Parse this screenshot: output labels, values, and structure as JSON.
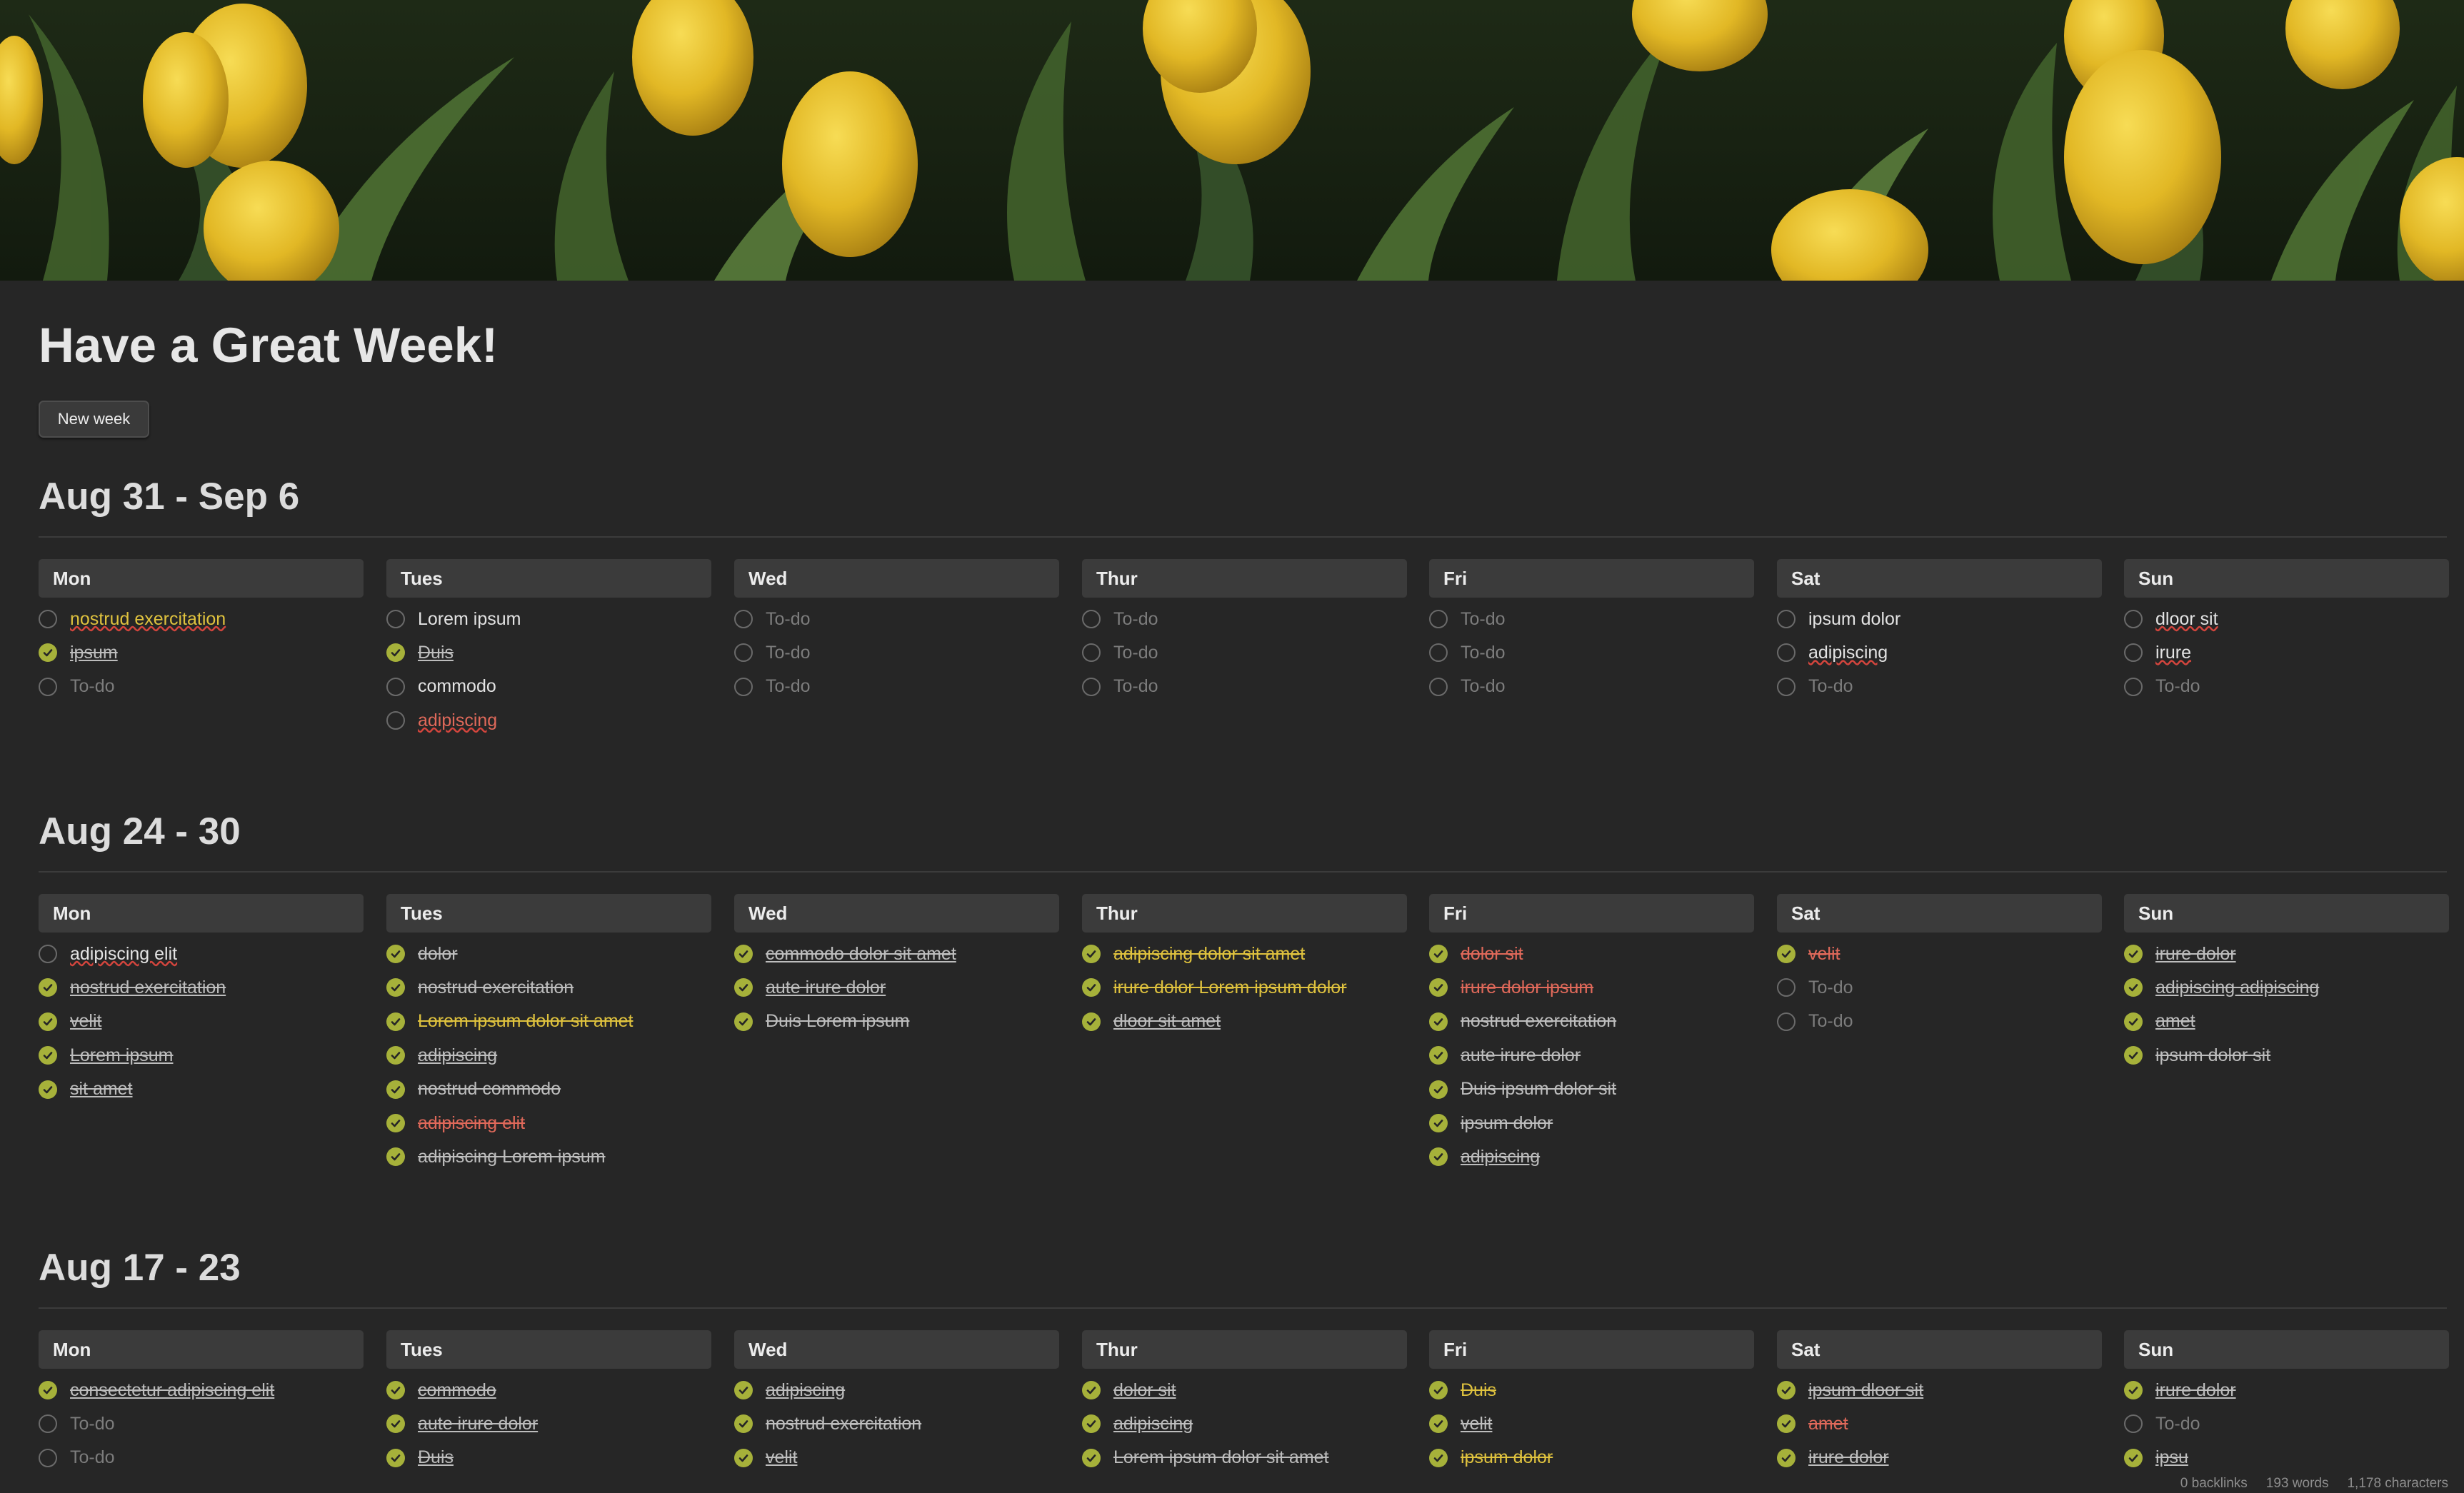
{
  "page": {
    "title": "Have a Great Week!",
    "new_week_button": "New week"
  },
  "colors": {
    "background": "#262626",
    "header_bg": "#3b3b3b",
    "check_done": "#a6b13a",
    "highlight_yellow": "#dfc23e",
    "highlight_red": "#e0695a"
  },
  "weeks": [
    {
      "heading": "Aug 31 - Sep 6",
      "days": [
        {
          "name": "Mon",
          "tasks": [
            {
              "text": "nostrud exercitation",
              "done": false,
              "style": "yellow",
              "spell": true
            },
            {
              "text": "ipsum",
              "done": true,
              "spell": true
            },
            {
              "text": "To-do",
              "done": false,
              "placeholder": true
            }
          ]
        },
        {
          "name": "Tues",
          "tasks": [
            {
              "text": "Lorem ipsum",
              "done": false
            },
            {
              "text": "Duis",
              "done": true,
              "spell": true
            },
            {
              "text": "commodo",
              "done": false
            },
            {
              "text": "adipiscing",
              "done": false,
              "style": "red",
              "spell": true
            }
          ]
        },
        {
          "name": "Wed",
          "tasks": [
            {
              "text": "To-do",
              "done": false,
              "placeholder": true
            },
            {
              "text": "To-do",
              "done": false,
              "placeholder": true
            },
            {
              "text": "To-do",
              "done": false,
              "placeholder": true
            }
          ]
        },
        {
          "name": "Thur",
          "tasks": [
            {
              "text": "To-do",
              "done": false,
              "placeholder": true
            },
            {
              "text": "To-do",
              "done": false,
              "placeholder": true
            },
            {
              "text": "To-do",
              "done": false,
              "placeholder": true
            }
          ]
        },
        {
          "name": "Fri",
          "tasks": [
            {
              "text": "To-do",
              "done": false,
              "placeholder": true
            },
            {
              "text": "To-do",
              "done": false,
              "placeholder": true
            },
            {
              "text": "To-do",
              "done": false,
              "placeholder": true
            }
          ]
        },
        {
          "name": "Sat",
          "tasks": [
            {
              "text": "ipsum dolor",
              "done": false
            },
            {
              "text": "adipiscing",
              "done": false,
              "spell": true
            },
            {
              "text": "To-do",
              "done": false,
              "placeholder": true
            }
          ]
        },
        {
          "name": "Sun",
          "tasks": [
            {
              "text": "dloor sit",
              "done": false,
              "spell": true
            },
            {
              "text": "irure",
              "done": false,
              "spell": true
            },
            {
              "text": "To-do",
              "done": false,
              "placeholder": true
            }
          ]
        }
      ]
    },
    {
      "heading": "Aug 24 - 30",
      "days": [
        {
          "name": "Mon",
          "tasks": [
            {
              "text": "adipiscing elit",
              "done": false,
              "spell": true
            },
            {
              "text": "nostrud exercitation",
              "done": true,
              "spell": true
            },
            {
              "text": "velit",
              "done": true,
              "spell": true
            },
            {
              "text": "Lorem ipsum",
              "done": true,
              "spell": true
            },
            {
              "text": "sit amet",
              "done": true,
              "spell": true
            }
          ]
        },
        {
          "name": "Tues",
          "tasks": [
            {
              "text": "dolor",
              "done": true
            },
            {
              "text": "nostrud exercitation",
              "done": true
            },
            {
              "text": "Lorem ipsum dolor sit amet",
              "done": true,
              "style": "yellow"
            },
            {
              "text": "adipiscing",
              "done": true,
              "spell": true
            },
            {
              "text": "nostrud commodo",
              "done": true
            },
            {
              "text": "adipiscing elit",
              "done": true,
              "style": "red"
            },
            {
              "text": "adipiscing Lorem ipsum",
              "done": true
            }
          ]
        },
        {
          "name": "Wed",
          "tasks": [
            {
              "text": "commodo dolor sit amet",
              "done": true,
              "spell": true
            },
            {
              "text": "aute irure dolor",
              "done": true,
              "spell": true
            },
            {
              "text": "Duis Lorem ipsum",
              "done": true
            }
          ]
        },
        {
          "name": "Thur",
          "tasks": [
            {
              "text": "adipiscing dolor sit amet",
              "done": true,
              "style": "yellow"
            },
            {
              "text": "irure dolor Lorem ipsum dolor",
              "done": true,
              "style": "yellow"
            },
            {
              "text": "dloor sit amet",
              "done": true,
              "spell": true
            }
          ]
        },
        {
          "name": "Fri",
          "tasks": [
            {
              "text": "dolor sit",
              "done": true,
              "style": "red"
            },
            {
              "text": "irure dolor ipsum",
              "done": true,
              "style": "red"
            },
            {
              "text": "nostrud exercitation",
              "done": true
            },
            {
              "text": "aute irure dolor",
              "done": true
            },
            {
              "text": "Duis  ipsum dolor sit",
              "done": true
            },
            {
              "text": "ipsum dolor",
              "done": true
            },
            {
              "text": "adipiscing",
              "done": true,
              "spell": true
            }
          ]
        },
        {
          "name": "Sat",
          "tasks": [
            {
              "text": "velit",
              "done": true,
              "style": "red"
            },
            {
              "text": "To-do",
              "done": false,
              "placeholder": true
            },
            {
              "text": "To-do",
              "done": false,
              "placeholder": true
            }
          ]
        },
        {
          "name": "Sun",
          "tasks": [
            {
              "text": "irure dolor",
              "done": true,
              "spell": true
            },
            {
              "text": "adipiscing adipiscing",
              "done": true,
              "spell": true
            },
            {
              "text": "amet",
              "done": true,
              "spell": true
            },
            {
              "text": "ipsum dolor sit",
              "done": true
            }
          ]
        }
      ]
    },
    {
      "heading": "Aug 17 - 23",
      "days": [
        {
          "name": "Mon",
          "tasks": [
            {
              "text": "consectetur adipiscing elit",
              "done": true,
              "spell": true
            },
            {
              "text": "To-do",
              "done": false,
              "placeholder": true
            },
            {
              "text": "To-do",
              "done": false,
              "placeholder": true
            }
          ]
        },
        {
          "name": "Tues",
          "tasks": [
            {
              "text": "commodo",
              "done": true,
              "spell": true
            },
            {
              "text": "aute irure dolor",
              "done": true,
              "spell": true
            },
            {
              "text": "Duis",
              "done": true,
              "spell": true
            }
          ]
        },
        {
          "name": "Wed",
          "tasks": [
            {
              "text": "adipiscing",
              "done": true,
              "spell": true
            },
            {
              "text": "nostrud exercitation",
              "done": true
            },
            {
              "text": "velit",
              "done": true,
              "spell": true
            }
          ]
        },
        {
          "name": "Thur",
          "tasks": [
            {
              "text": "dolor sit",
              "done": true,
              "spell": true
            },
            {
              "text": "adipiscing",
              "done": true,
              "spell": true
            },
            {
              "text": "Lorem ipsum dolor sit amet",
              "done": true
            }
          ]
        },
        {
          "name": "Fri",
          "tasks": [
            {
              "text": "Duis",
              "done": true,
              "style": "yellow"
            },
            {
              "text": "velit",
              "done": true,
              "spell": true
            },
            {
              "text": "ipsum dolor",
              "done": true,
              "style": "yellow"
            }
          ]
        },
        {
          "name": "Sat",
          "tasks": [
            {
              "text": "ipsum dloor sit",
              "done": true,
              "spell": true
            },
            {
              "text": "amet",
              "done": true,
              "style": "red"
            },
            {
              "text": "irure dolor",
              "done": true,
              "spell": true
            }
          ]
        },
        {
          "name": "Sun",
          "tasks": [
            {
              "text": "irure dolor",
              "done": true,
              "spell": true
            },
            {
              "text": "To-do",
              "done": false,
              "placeholder": true
            },
            {
              "text": "ipsu",
              "done": true,
              "spell": true
            }
          ]
        }
      ]
    }
  ],
  "status_bar": {
    "backlinks": "0 backlinks",
    "words": "193 words",
    "characters": "1,178 characters"
  }
}
